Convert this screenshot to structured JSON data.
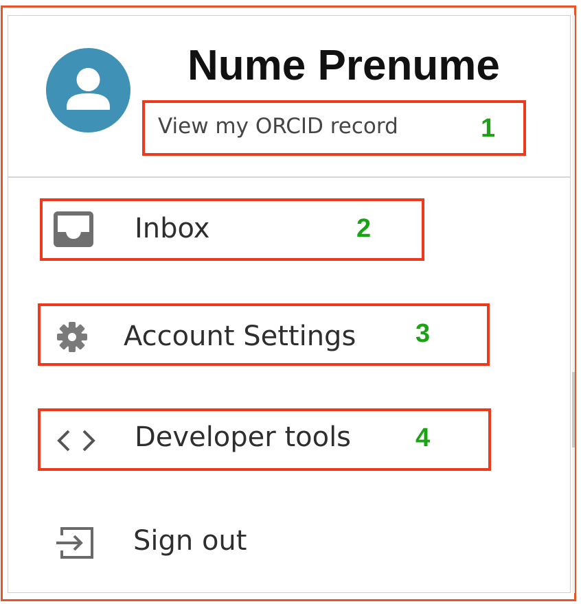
{
  "profile": {
    "name": "Nume Prenume",
    "view_record_label": "View my ORCID record",
    "avatar_icon": "user-avatar-icon",
    "avatar_color": "#3f91b5"
  },
  "menu": {
    "items": [
      {
        "label": "Inbox",
        "icon": "inbox-icon"
      },
      {
        "label": "Account Settings",
        "icon": "gear-icon"
      },
      {
        "label": "Developer tools",
        "icon": "code-brackets-icon"
      },
      {
        "label": "Sign out",
        "icon": "sign-out-icon"
      }
    ]
  },
  "annotations": {
    "box_color": "#ee3a1c",
    "number_color": "#1aa313",
    "labels": [
      "1",
      "2",
      "3",
      "4"
    ]
  }
}
